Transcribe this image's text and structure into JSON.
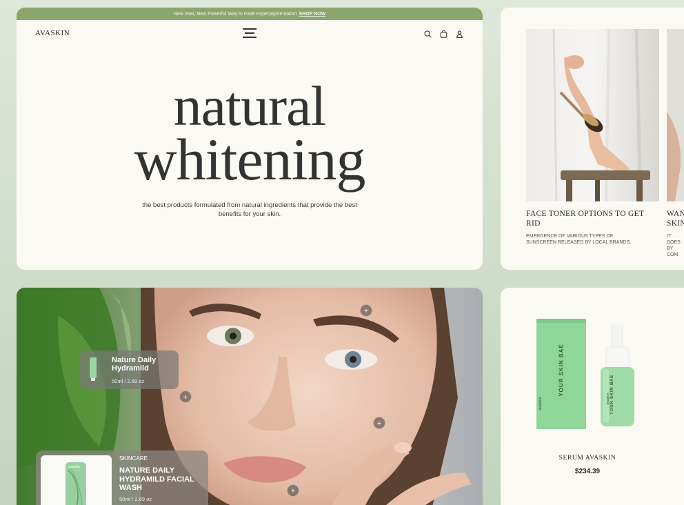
{
  "announcement": {
    "text": "New Year, New Powerful Way to Fade Hyperpigmentation",
    "link": "SHOP NOW"
  },
  "brand": "AVASKIN",
  "hero": {
    "title_line1": "natural",
    "title_line2": "whitening",
    "subtitle": "the best products formulated from natural ingredients that provide the best benefits for your skin."
  },
  "articles": [
    {
      "title": "FACE TONER OPTIONS TO GET RID",
      "description": "EMERGENCE OF VARIOUS TYPES OF SUNSCREEN RELEASED BY LOCAL BRANDS,"
    },
    {
      "title": "WAN SKIN",
      "description": "IT DOES BY COM"
    }
  ],
  "hotspot_symbol": "+",
  "tooltip_small": {
    "name": "Nature Daily Hydramild",
    "size": "50ml / 2.69 oz"
  },
  "tooltip_large": {
    "category": "SKINCARE",
    "name": "NATURE DAILY HYDRAMILD FACIAL WASH",
    "size": "50ml / 2.69 oz",
    "thumb_brand": "avaskin"
  },
  "product": {
    "name": "SERUM AVASKIN",
    "price": "$234.39",
    "box_title": "YOUR SKIN BAE",
    "box_brand": "avaskin",
    "bottle_title": "YOUR SKIN BAE",
    "bottle_brand": "avaskin"
  },
  "colors": {
    "accent": "#8aa66c",
    "card": "#fbf9f4",
    "background": "#d3dfcd",
    "product_green": "#8fd69a"
  },
  "icons": [
    "search-icon",
    "bag-icon",
    "user-icon",
    "menu-icon",
    "plus-icon"
  ]
}
